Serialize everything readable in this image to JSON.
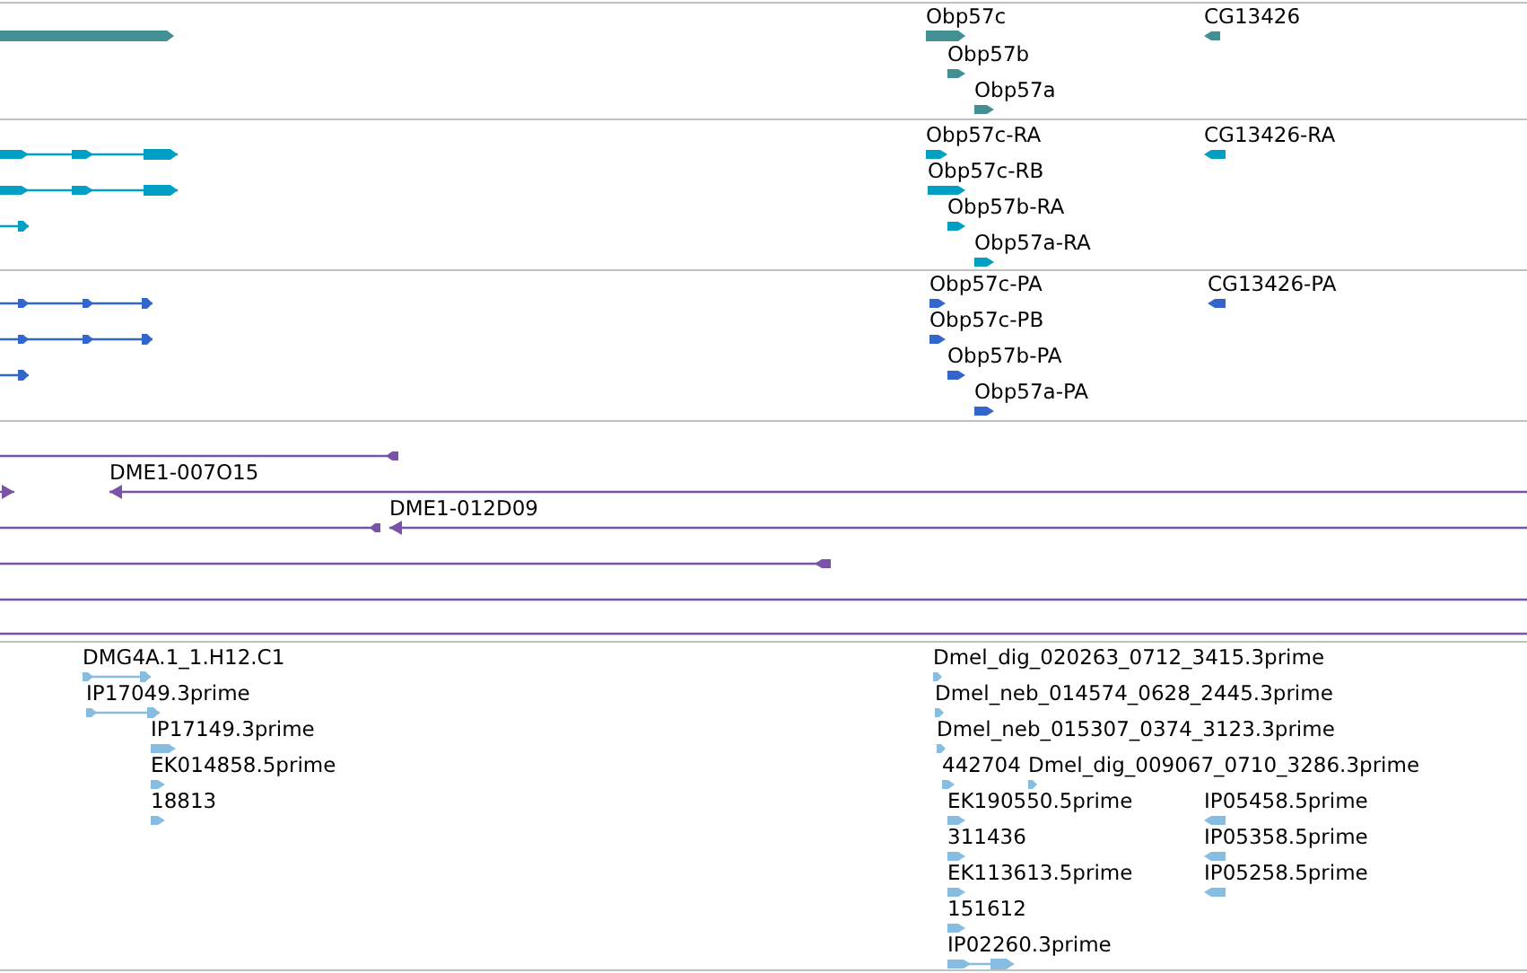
{
  "tracks": [
    {
      "kind": "gene",
      "color": "#428f94",
      "features": [
        {
          "label": "Obp57c",
          "reverse": false
        },
        {
          "label": "Obp57b",
          "reverse": false
        },
        {
          "label": "Obp57a",
          "reverse": false
        },
        {
          "label": "CG13426",
          "reverse": true
        }
      ]
    },
    {
      "kind": "transcript",
      "color": "#00a0c4",
      "features": [
        {
          "label": "Obp57c-RA",
          "reverse": false
        },
        {
          "label": "Obp57c-RB",
          "reverse": false
        },
        {
          "label": "Obp57b-RA",
          "reverse": false
        },
        {
          "label": "Obp57a-RA",
          "reverse": false
        },
        {
          "label": "CG13426-RA",
          "reverse": true
        }
      ]
    },
    {
      "kind": "protein",
      "color": "#3366cc",
      "features": [
        {
          "label": "Obp57c-PA",
          "reverse": false
        },
        {
          "label": "Obp57c-PB",
          "reverse": false
        },
        {
          "label": "Obp57b-PA",
          "reverse": false
        },
        {
          "label": "Obp57a-PA",
          "reverse": false
        },
        {
          "label": "CG13426-PA",
          "reverse": true
        }
      ]
    },
    {
      "kind": "clone",
      "color": "#7a52a6",
      "features": [
        {
          "label": "DME1-007O15",
          "reverse": true
        },
        {
          "label": "DME1-012D09",
          "reverse": true
        }
      ]
    },
    {
      "kind": "est",
      "color": "#86bde0",
      "features": [
        {
          "label": "DMG4A.1_1.H12.C1",
          "reverse": false
        },
        {
          "label": "IP17049.3prime",
          "reverse": false
        },
        {
          "label": "IP17149.3prime",
          "reverse": false
        },
        {
          "label": "EK014858.5prime",
          "reverse": false
        },
        {
          "label": "18813",
          "reverse": false
        },
        {
          "label": "Dmel_dig_020263_0712_3415.3prime",
          "reverse": false
        },
        {
          "label": "Dmel_neb_014574_0628_2445.3prime",
          "reverse": false
        },
        {
          "label": "Dmel_neb_015307_0374_3123.3prime",
          "reverse": false
        },
        {
          "label": "442704",
          "reverse": false
        },
        {
          "label": "Dmel_dig_009067_0710_3286.3prime",
          "reverse": false
        },
        {
          "label": "EK190550.5prime",
          "reverse": false
        },
        {
          "label": "IP05458.5prime",
          "reverse": true
        },
        {
          "label": "311436",
          "reverse": false
        },
        {
          "label": "IP05358.5prime",
          "reverse": true
        },
        {
          "label": "EK113613.5prime",
          "reverse": false
        },
        {
          "label": "IP05258.5prime",
          "reverse": true
        },
        {
          "label": "151612",
          "reverse": false
        },
        {
          "label": "IP02260.3prime",
          "reverse": false
        }
      ]
    }
  ]
}
